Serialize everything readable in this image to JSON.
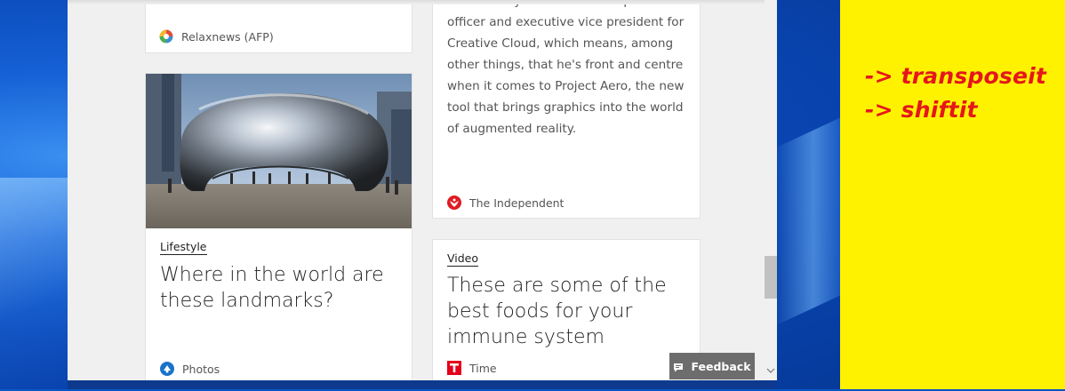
{
  "annotations": {
    "line1": "-> transposeit",
    "line2": "-> shiftit"
  },
  "cards": {
    "relaxnews": {
      "source": "Relaxnews (AFP)"
    },
    "independent": {
      "text": "Scott Belsky is Adobe's chief product\nofficer and executive vice president for\nCreative Cloud, which means, among\nother things, that he's front and centre\nwhen it comes to Project Aero, the new\ntool that brings graphics into the world\nof augmented reality.",
      "source": "The Independent"
    },
    "landmarks": {
      "category": "Lifestyle",
      "headline": "Where in the world are these landmarks?",
      "source": "Photos"
    },
    "foods": {
      "category": "Video",
      "headline": "These are some of the best foods for your immune system",
      "source": "Time"
    }
  },
  "feedback": {
    "label": "Feedback"
  },
  "colors": {
    "note_red": "#e4171c",
    "panel_yellow": "#fff200",
    "independent_red": "#e01b22",
    "time_red": "#e3001b",
    "photos_blue": "#1a73c9"
  },
  "icons": {
    "relaxnews": "relaxnews-logo-icon",
    "independent": "independent-eagle-icon",
    "photos": "photos-icon",
    "time": "time-logo-icon",
    "feedback": "feedback-chat-icon",
    "scroll_down": "chevron-down-icon"
  }
}
